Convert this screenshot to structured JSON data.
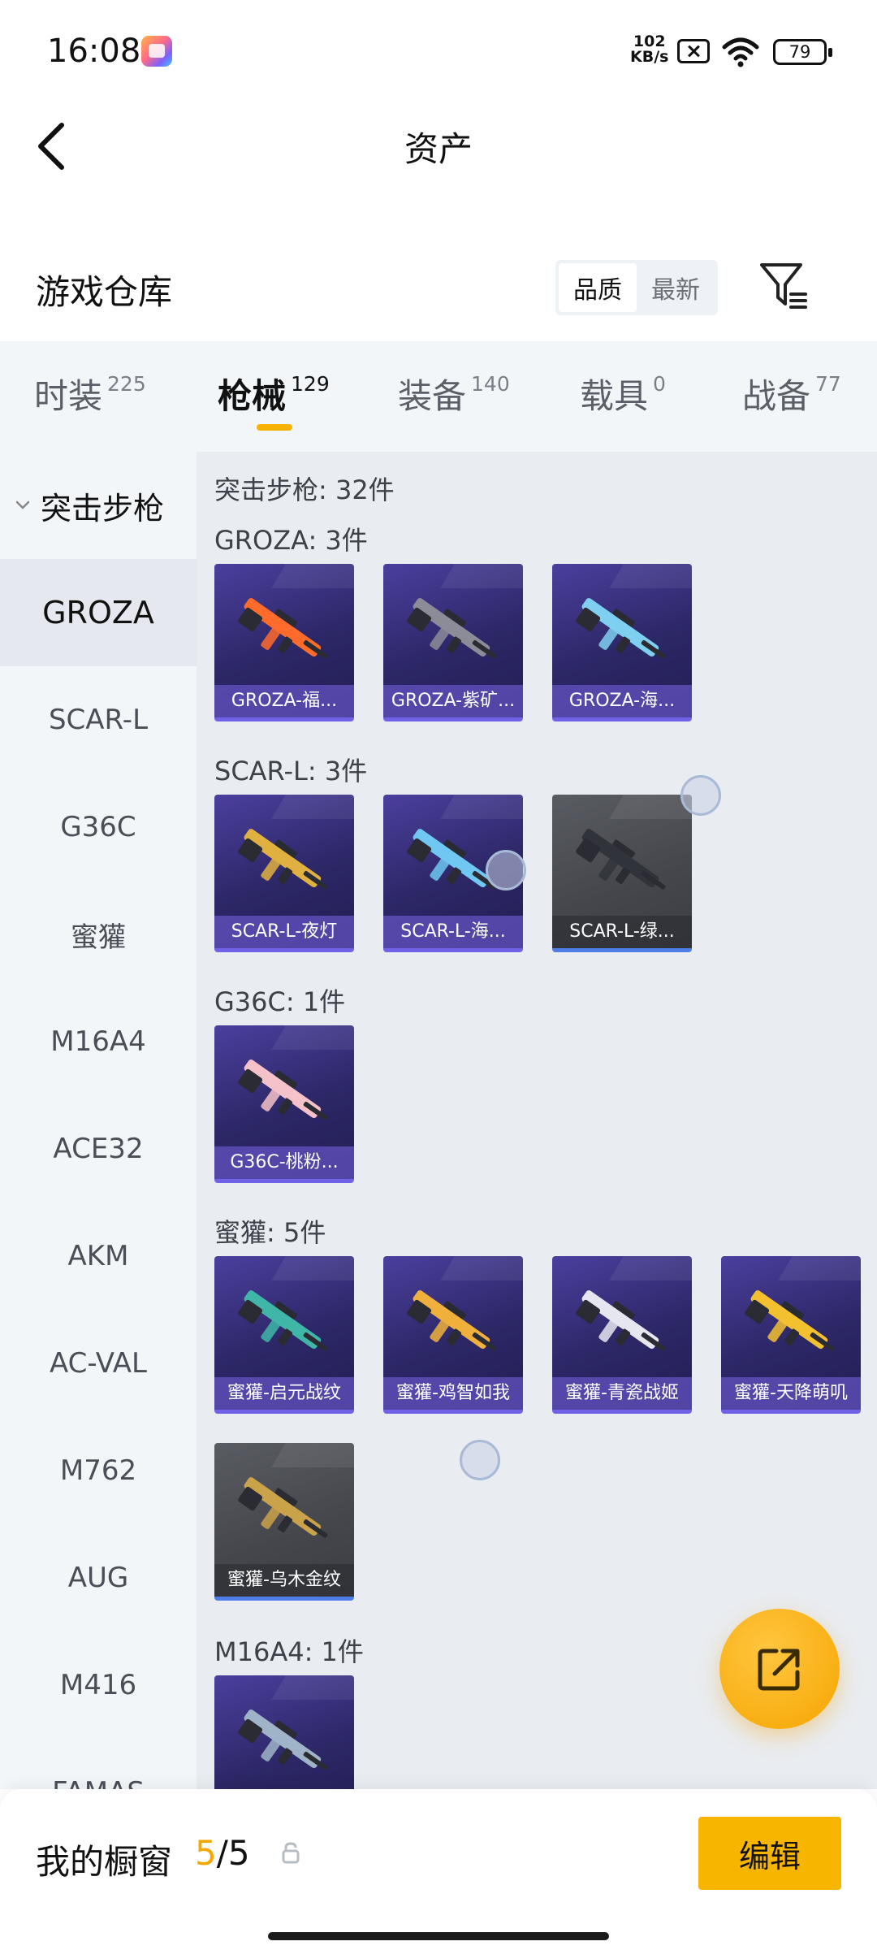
{
  "status_bar": {
    "time": "16:08",
    "net_speed_value": "102",
    "net_speed_unit": "KB/s",
    "battery": "79"
  },
  "header": {
    "title": "资产"
  },
  "warehouse": {
    "title": "游戏仓库",
    "sort_options": [
      "品质",
      "最新"
    ],
    "active_sort": "品质"
  },
  "tabs": [
    {
      "label": "时装",
      "count": "225"
    },
    {
      "label": "枪械",
      "count": "129"
    },
    {
      "label": "装备",
      "count": "140"
    },
    {
      "label": "载具",
      "count": "0"
    },
    {
      "label": "战备",
      "count": "77"
    }
  ],
  "active_tab": "枪械",
  "sidebar": {
    "group": "突击步枪",
    "items": [
      "GROZA",
      "SCAR-L",
      "G36C",
      "蜜獾",
      "M16A4",
      "ACE32",
      "AKM",
      "AC-VAL",
      "M762",
      "AUG",
      "M416",
      "FAMAS"
    ],
    "active_item": "GROZA"
  },
  "content": {
    "total_label": "突击步枪: 32件",
    "sections": [
      {
        "label": "GROZA: 3件",
        "items": [
          {
            "name": "GROZA-福...",
            "style": "purple",
            "accent": "#ff6b2b"
          },
          {
            "name": "GROZA-紫矿...",
            "style": "purple",
            "accent": "#8c8c99"
          },
          {
            "name": "GROZA-海...",
            "style": "purple",
            "accent": "#7fd0f0"
          }
        ]
      },
      {
        "label": "SCAR-L: 3件",
        "items": [
          {
            "name": "SCAR-L-夜灯",
            "style": "purple",
            "accent": "#e0b040"
          },
          {
            "name": "SCAR-L-海...",
            "style": "purple",
            "accent": "#6fc7f2"
          },
          {
            "name": "SCAR-L-绿...",
            "style": "grey",
            "accent": "#30343a"
          }
        ]
      },
      {
        "label": "G36C: 1件",
        "items": [
          {
            "name": "G36C-桃粉...",
            "style": "purple",
            "accent": "#f4c2c8"
          }
        ]
      },
      {
        "label": "蜜獾: 5件",
        "items": [
          {
            "name": "蜜獾-启元战纹",
            "style": "purple",
            "accent": "#3fb6a8"
          },
          {
            "name": "蜜獾-鸡智如我",
            "style": "purple",
            "accent": "#f0b13c"
          },
          {
            "name": "蜜獾-青瓷战姬",
            "style": "purple",
            "accent": "#e6e6f0"
          },
          {
            "name": "蜜獾-天降萌叽",
            "style": "purple",
            "accent": "#f3c12f"
          },
          {
            "name": "蜜獾-乌木金纹",
            "style": "grey",
            "accent": "#caa24a"
          }
        ]
      },
      {
        "label": "M16A4: 1件",
        "items": [
          {
            "name": "",
            "style": "purple",
            "accent": "#9fb4c8"
          }
        ]
      }
    ]
  },
  "bottom_bar": {
    "label": "我的橱窗",
    "count_current": "5",
    "count_sep": "/",
    "count_total": "5",
    "edit_label": "编辑"
  },
  "colors": {
    "accent": "#f7b500",
    "card_purple": "#2c2766",
    "card_grey": "#44464c"
  }
}
